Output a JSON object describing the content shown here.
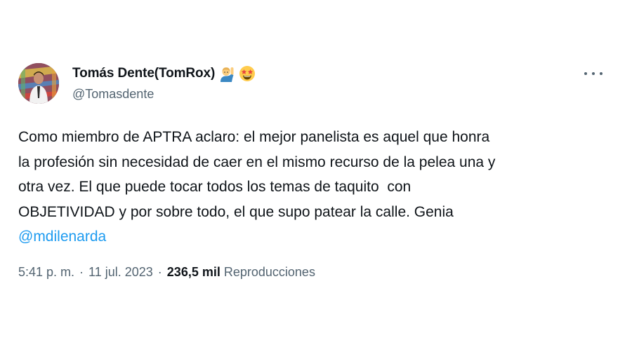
{
  "author": {
    "display_name": "Tomás Dente(TomRox)",
    "handle": "@Tomasdente",
    "emojis": [
      "person-raising-hand-emoji",
      "star-struck-emoji"
    ]
  },
  "menu": {
    "icon": "more-dots-icon"
  },
  "tweet": {
    "lines": [
      "Como miembro de APTRA aclaro: el mejor panelista es aquel que honra",
      "la profesión sin necesidad de caer en el mismo recurso de la pelea una y",
      "otra vez. El que puede tocar todos los temas de taquito  con",
      "OBJETIVIDAD y por sobre todo, el que supo patear la calle. Genia"
    ],
    "mention": "@mdilenarda"
  },
  "meta": {
    "time": "5:41 p. m.",
    "separator": "·",
    "date": "11 jul. 2023",
    "views_count": "236,5 mil",
    "views_label": "Reproducciones"
  },
  "colors": {
    "text": "#0f1419",
    "secondary": "#536471",
    "link": "#1d9bf0"
  }
}
